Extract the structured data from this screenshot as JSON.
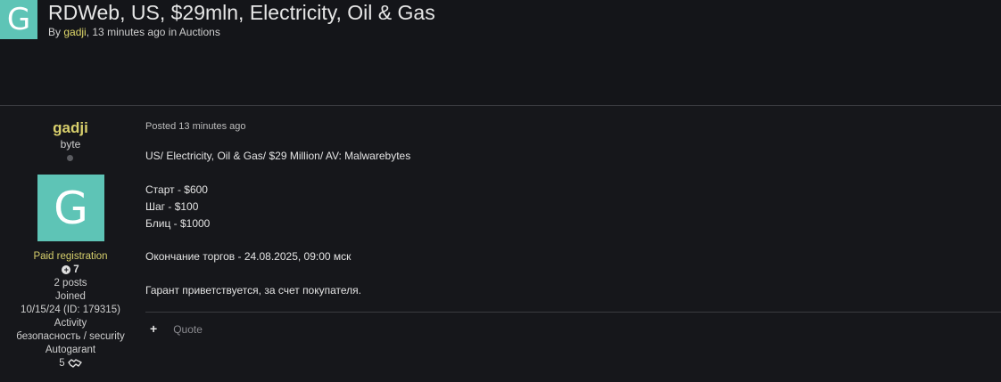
{
  "thread": {
    "avatar_letter": "G",
    "title": "RDWeb, US, $29mln, Electricity, Oil & Gas",
    "meta_by": "By",
    "author": "gadji",
    "meta_rest": ", 13 minutes ago in Auctions"
  },
  "user": {
    "name": "gadji",
    "rank": "byte",
    "avatar_letter": "G",
    "group": "Paid registration",
    "reputation": "7",
    "posts": "2 posts",
    "joined_label": "Joined",
    "joined_value": "10/15/24 (ID: 179315)",
    "activity_label": "Activity",
    "activity_value": "безопасность / security",
    "autogarant_label": "Autogarant",
    "autogarant_value": "5"
  },
  "post": {
    "posted": "Posted 13 minutes ago",
    "lines": [
      "US/ Electricity, Oil & Gas/ $29 Million/ AV: Malwarebytes",
      "",
      "Старт - $600",
      "Шаг - $100",
      "Блиц - $1000",
      "",
      "Окончание торгов - 24.08.2025, 09:00 мск",
      "",
      "Гарант приветствуется, за счет покупателя."
    ],
    "quote_label": "Quote"
  },
  "colors": {
    "background": "#16171b",
    "accent_avatar": "#5ec4b6",
    "username": "#d8cf6c",
    "text": "#e3e3e3",
    "muted": "#8a8a8f"
  },
  "icons": [
    "status-dot-icon",
    "reputation-plus-icon",
    "handshake-icon",
    "plus-icon"
  ]
}
